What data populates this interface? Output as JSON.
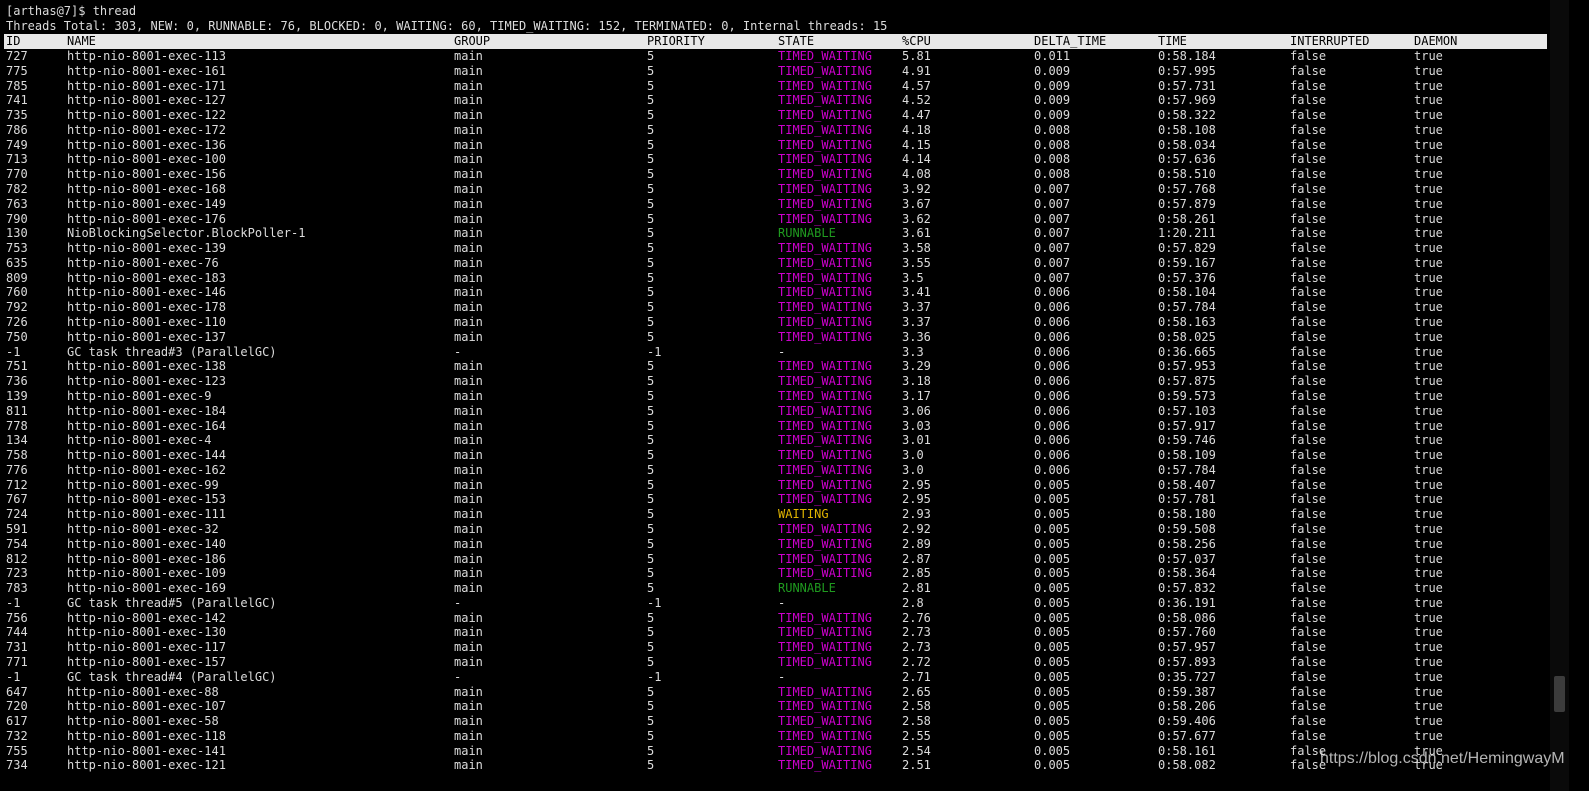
{
  "terminal": {
    "prompt": "[arthas@7]$ thread",
    "summary": "Threads Total: 303, NEW: 0, RUNNABLE: 76, BLOCKED: 0, WAITING: 60, TIMED_WAITING: 152, TERMINATED: 0, Internal threads: 15"
  },
  "colors": {
    "background": "#000000",
    "text": "#dcdcdc",
    "header_bg": "#e8e8e8",
    "timed_waiting": "#cc00cc",
    "runnable": "#1f9a1f",
    "waiting": "#e0b400"
  },
  "table": {
    "columns": [
      "ID",
      "NAME",
      "GROUP",
      "PRIORITY",
      "STATE",
      "%CPU",
      "DELTA_TIME",
      "TIME",
      "INTERRUPTED",
      "DAEMON"
    ],
    "rows": [
      [
        "727",
        "http-nio-8001-exec-113",
        "main",
        "5",
        "TIMED_WAITING",
        "5.81",
        "0.011",
        "0:58.184",
        "false",
        "true"
      ],
      [
        "775",
        "http-nio-8001-exec-161",
        "main",
        "5",
        "TIMED_WAITING",
        "4.91",
        "0.009",
        "0:57.995",
        "false",
        "true"
      ],
      [
        "785",
        "http-nio-8001-exec-171",
        "main",
        "5",
        "TIMED_WAITING",
        "4.57",
        "0.009",
        "0:57.731",
        "false",
        "true"
      ],
      [
        "741",
        "http-nio-8001-exec-127",
        "main",
        "5",
        "TIMED_WAITING",
        "4.52",
        "0.009",
        "0:57.969",
        "false",
        "true"
      ],
      [
        "735",
        "http-nio-8001-exec-122",
        "main",
        "5",
        "TIMED_WAITING",
        "4.47",
        "0.009",
        "0:58.322",
        "false",
        "true"
      ],
      [
        "786",
        "http-nio-8001-exec-172",
        "main",
        "5",
        "TIMED_WAITING",
        "4.18",
        "0.008",
        "0:58.108",
        "false",
        "true"
      ],
      [
        "749",
        "http-nio-8001-exec-136",
        "main",
        "5",
        "TIMED_WAITING",
        "4.15",
        "0.008",
        "0:58.034",
        "false",
        "true"
      ],
      [
        "713",
        "http-nio-8001-exec-100",
        "main",
        "5",
        "TIMED_WAITING",
        "4.14",
        "0.008",
        "0:57.636",
        "false",
        "true"
      ],
      [
        "770",
        "http-nio-8001-exec-156",
        "main",
        "5",
        "TIMED_WAITING",
        "4.08",
        "0.008",
        "0:58.510",
        "false",
        "true"
      ],
      [
        "782",
        "http-nio-8001-exec-168",
        "main",
        "5",
        "TIMED_WAITING",
        "3.92",
        "0.007",
        "0:57.768",
        "false",
        "true"
      ],
      [
        "763",
        "http-nio-8001-exec-149",
        "main",
        "5",
        "TIMED_WAITING",
        "3.67",
        "0.007",
        "0:57.879",
        "false",
        "true"
      ],
      [
        "790",
        "http-nio-8001-exec-176",
        "main",
        "5",
        "TIMED_WAITING",
        "3.62",
        "0.007",
        "0:58.261",
        "false",
        "true"
      ],
      [
        "130",
        "NioBlockingSelector.BlockPoller-1",
        "main",
        "5",
        "RUNNABLE",
        "3.61",
        "0.007",
        "1:20.211",
        "false",
        "true"
      ],
      [
        "753",
        "http-nio-8001-exec-139",
        "main",
        "5",
        "TIMED_WAITING",
        "3.58",
        "0.007",
        "0:57.829",
        "false",
        "true"
      ],
      [
        "635",
        "http-nio-8001-exec-76",
        "main",
        "5",
        "TIMED_WAITING",
        "3.55",
        "0.007",
        "0:59.167",
        "false",
        "true"
      ],
      [
        "809",
        "http-nio-8001-exec-183",
        "main",
        "5",
        "TIMED_WAITING",
        "3.5",
        "0.007",
        "0:57.376",
        "false",
        "true"
      ],
      [
        "760",
        "http-nio-8001-exec-146",
        "main",
        "5",
        "TIMED_WAITING",
        "3.41",
        "0.006",
        "0:58.104",
        "false",
        "true"
      ],
      [
        "792",
        "http-nio-8001-exec-178",
        "main",
        "5",
        "TIMED_WAITING",
        "3.37",
        "0.006",
        "0:57.784",
        "false",
        "true"
      ],
      [
        "726",
        "http-nio-8001-exec-110",
        "main",
        "5",
        "TIMED_WAITING",
        "3.37",
        "0.006",
        "0:58.163",
        "false",
        "true"
      ],
      [
        "750",
        "http-nio-8001-exec-137",
        "main",
        "5",
        "TIMED_WAITING",
        "3.36",
        "0.006",
        "0:58.025",
        "false",
        "true"
      ],
      [
        "-1",
        "GC task thread#3 (ParallelGC)",
        "-",
        "-1",
        "-",
        "3.3",
        "0.006",
        "0:36.665",
        "false",
        "true"
      ],
      [
        "751",
        "http-nio-8001-exec-138",
        "main",
        "5",
        "TIMED_WAITING",
        "3.29",
        "0.006",
        "0:57.953",
        "false",
        "true"
      ],
      [
        "736",
        "http-nio-8001-exec-123",
        "main",
        "5",
        "TIMED_WAITING",
        "3.18",
        "0.006",
        "0:57.875",
        "false",
        "true"
      ],
      [
        "139",
        "http-nio-8001-exec-9",
        "main",
        "5",
        "TIMED_WAITING",
        "3.17",
        "0.006",
        "0:59.573",
        "false",
        "true"
      ],
      [
        "811",
        "http-nio-8001-exec-184",
        "main",
        "5",
        "TIMED_WAITING",
        "3.06",
        "0.006",
        "0:57.103",
        "false",
        "true"
      ],
      [
        "778",
        "http-nio-8001-exec-164",
        "main",
        "5",
        "TIMED_WAITING",
        "3.03",
        "0.006",
        "0:57.917",
        "false",
        "true"
      ],
      [
        "134",
        "http-nio-8001-exec-4",
        "main",
        "5",
        "TIMED_WAITING",
        "3.01",
        "0.006",
        "0:59.746",
        "false",
        "true"
      ],
      [
        "758",
        "http-nio-8001-exec-144",
        "main",
        "5",
        "TIMED_WAITING",
        "3.0",
        "0.006",
        "0:58.109",
        "false",
        "true"
      ],
      [
        "776",
        "http-nio-8001-exec-162",
        "main",
        "5",
        "TIMED_WAITING",
        "3.0",
        "0.006",
        "0:57.784",
        "false",
        "true"
      ],
      [
        "712",
        "http-nio-8001-exec-99",
        "main",
        "5",
        "TIMED_WAITING",
        "2.95",
        "0.005",
        "0:58.407",
        "false",
        "true"
      ],
      [
        "767",
        "http-nio-8001-exec-153",
        "main",
        "5",
        "TIMED_WAITING",
        "2.95",
        "0.005",
        "0:57.781",
        "false",
        "true"
      ],
      [
        "724",
        "http-nio-8001-exec-111",
        "main",
        "5",
        "WAITING",
        "2.93",
        "0.005",
        "0:58.180",
        "false",
        "true"
      ],
      [
        "591",
        "http-nio-8001-exec-32",
        "main",
        "5",
        "TIMED_WAITING",
        "2.92",
        "0.005",
        "0:59.508",
        "false",
        "true"
      ],
      [
        "754",
        "http-nio-8001-exec-140",
        "main",
        "5",
        "TIMED_WAITING",
        "2.89",
        "0.005",
        "0:58.256",
        "false",
        "true"
      ],
      [
        "812",
        "http-nio-8001-exec-186",
        "main",
        "5",
        "TIMED_WAITING",
        "2.87",
        "0.005",
        "0:57.037",
        "false",
        "true"
      ],
      [
        "723",
        "http-nio-8001-exec-109",
        "main",
        "5",
        "TIMED_WAITING",
        "2.85",
        "0.005",
        "0:58.364",
        "false",
        "true"
      ],
      [
        "783",
        "http-nio-8001-exec-169",
        "main",
        "5",
        "RUNNABLE",
        "2.81",
        "0.005",
        "0:57.832",
        "false",
        "true"
      ],
      [
        "-1",
        "GC task thread#5 (ParallelGC)",
        "-",
        "-1",
        "-",
        "2.8",
        "0.005",
        "0:36.191",
        "false",
        "true"
      ],
      [
        "756",
        "http-nio-8001-exec-142",
        "main",
        "5",
        "TIMED_WAITING",
        "2.76",
        "0.005",
        "0:58.086",
        "false",
        "true"
      ],
      [
        "744",
        "http-nio-8001-exec-130",
        "main",
        "5",
        "TIMED_WAITING",
        "2.73",
        "0.005",
        "0:57.760",
        "false",
        "true"
      ],
      [
        "731",
        "http-nio-8001-exec-117",
        "main",
        "5",
        "TIMED_WAITING",
        "2.73",
        "0.005",
        "0:57.957",
        "false",
        "true"
      ],
      [
        "771",
        "http-nio-8001-exec-157",
        "main",
        "5",
        "TIMED_WAITING",
        "2.72",
        "0.005",
        "0:57.893",
        "false",
        "true"
      ],
      [
        "-1",
        "GC task thread#4 (ParallelGC)",
        "-",
        "-1",
        "-",
        "2.71",
        "0.005",
        "0:35.727",
        "false",
        "true"
      ],
      [
        "647",
        "http-nio-8001-exec-88",
        "main",
        "5",
        "TIMED_WAITING",
        "2.65",
        "0.005",
        "0:59.387",
        "false",
        "true"
      ],
      [
        "720",
        "http-nio-8001-exec-107",
        "main",
        "5",
        "TIMED_WAITING",
        "2.58",
        "0.005",
        "0:58.206",
        "false",
        "true"
      ],
      [
        "617",
        "http-nio-8001-exec-58",
        "main",
        "5",
        "TIMED_WAITING",
        "2.58",
        "0.005",
        "0:59.406",
        "false",
        "true"
      ],
      [
        "732",
        "http-nio-8001-exec-118",
        "main",
        "5",
        "TIMED_WAITING",
        "2.55",
        "0.005",
        "0:57.677",
        "false",
        "true"
      ],
      [
        "755",
        "http-nio-8001-exec-141",
        "main",
        "5",
        "TIMED_WAITING",
        "2.54",
        "0.005",
        "0:58.161",
        "false",
        "true"
      ],
      [
        "734",
        "http-nio-8001-exec-121",
        "main",
        "5",
        "TIMED_WAITING",
        "2.51",
        "0.005",
        "0:58.082",
        "false",
        "true"
      ]
    ]
  },
  "watermark": "https://blog.csdn.net/HemingwayM"
}
